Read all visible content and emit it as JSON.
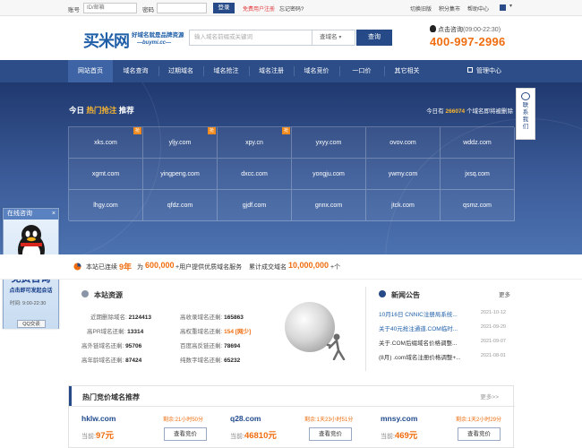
{
  "topbar": {
    "account_label": "账号",
    "account_placeholder": "ID/邮箱",
    "password_label": "密码",
    "login_button": "登录",
    "register_link": "免费用户注册",
    "forgot_link": "忘记密码?",
    "links": [
      "切换旧版",
      "积分集市",
      "帮助中心"
    ]
  },
  "header": {
    "logo_text": "买米网",
    "slogan": "好域名就是品牌资源",
    "slogan_sub": "—buymi.cc—",
    "search_placeholder": "输入域名前缀或关键词",
    "search_type": "查域名",
    "search_button": "查询",
    "consult_text": "点击咨询",
    "consult_hours": "(09:00-22:30)",
    "phone": "400-997-2996"
  },
  "nav": {
    "items": [
      "网站首页",
      "域名查询",
      "过期域名",
      "域名抢注",
      "域名注册",
      "域名竞价",
      "一口价",
      "其它相关"
    ],
    "admin": "管理中心"
  },
  "hero": {
    "title_prefix": "今日",
    "title_highlight": "热门抢注",
    "title_suffix": "推荐",
    "count_prefix": "今日有",
    "count": "266074",
    "count_suffix": "个域名即将被删除",
    "domains": [
      {
        "name": "xks.com",
        "tag": "抢"
      },
      {
        "name": "yljy.com",
        "tag": "抢"
      },
      {
        "name": "xpy.cn",
        "tag": "抢"
      },
      {
        "name": "yxyy.com",
        "tag": ""
      },
      {
        "name": "ovov.com",
        "tag": ""
      },
      {
        "name": "wddz.com",
        "tag": ""
      },
      {
        "name": "xgmt.com",
        "tag": ""
      },
      {
        "name": "yingpeng.com",
        "tag": ""
      },
      {
        "name": "dxcc.com",
        "tag": ""
      },
      {
        "name": "yongju.com",
        "tag": ""
      },
      {
        "name": "ywmy.com",
        "tag": ""
      },
      {
        "name": "jxsq.com",
        "tag": ""
      },
      {
        "name": "lhgy.com",
        "tag": ""
      },
      {
        "name": "qfdz.com",
        "tag": ""
      },
      {
        "name": "gjdf.com",
        "tag": ""
      },
      {
        "name": "gnnx.com",
        "tag": ""
      },
      {
        "name": "jtck.com",
        "tag": ""
      },
      {
        "name": "qsmz.com",
        "tag": ""
      }
    ]
  },
  "side_float": {
    "text": [
      "联",
      "系",
      "我",
      "们"
    ]
  },
  "qq_float": {
    "title": "在线咨询",
    "close": "×",
    "free": "免费咨询",
    "sub": "点击即可发起会话",
    "time": "时间:  9:00-22:30",
    "button": "QQ交谈"
  },
  "stats": {
    "p1": "本站已连续",
    "years": "9年",
    "p2": "为",
    "users": "600,000",
    "p3": "+用户提供优质域名服务",
    "p4": "累计成交域名",
    "deals": "10,000,000",
    "p5": "+个"
  },
  "resources": {
    "title": "本站资源",
    "rows": [
      {
        "label": "近期删除域名:",
        "value": "2124413",
        "label2": "高收录域名还剩:",
        "value2": "165863"
      },
      {
        "label": "高PR域名还剩:",
        "value": "13314",
        "label2": "高权重域名还剩:",
        "value2": "154 [网少]"
      },
      {
        "label": "高外链域名还剩:",
        "value": "95706",
        "label2": "百度高反链还剩:",
        "value2": "78694"
      },
      {
        "label": "高年龄域名还剩:",
        "value": "87424",
        "label2": "纯数字域名还剩:",
        "value2": "65232"
      }
    ]
  },
  "news": {
    "title": "新闻公告",
    "more": "更多",
    "items": [
      {
        "text": "10月16日 CNNIC注册局系统...",
        "date": "2021-10-12"
      },
      {
        "text": "关于40元抢注通道.COM临时...",
        "date": "2021-09-20"
      },
      {
        "text": "关于.COM后缀域名价格调整...",
        "date": "2021-09-07"
      },
      {
        "text": "(8月) .com域名注册价格调整+...",
        "date": "2021-08-01"
      }
    ]
  },
  "auction": {
    "title": "热门竞价域名推荐",
    "more": "更多>>",
    "price_prefix": "当前:",
    "button": "查看竞价",
    "items": [
      {
        "domain": "hklw.com",
        "remain": "剩余:21小时50分",
        "price": "97元"
      },
      {
        "domain": "q28.com",
        "remain": "剩余:1天23小时51分",
        "price": "46810元"
      },
      {
        "domain": "mnsy.com",
        "remain": "剩余:1天2小时29分",
        "price": "469元"
      }
    ]
  },
  "colors": {
    "brand": "#264a87",
    "accent": "#f06d0f",
    "nav": "#2c4d88"
  }
}
